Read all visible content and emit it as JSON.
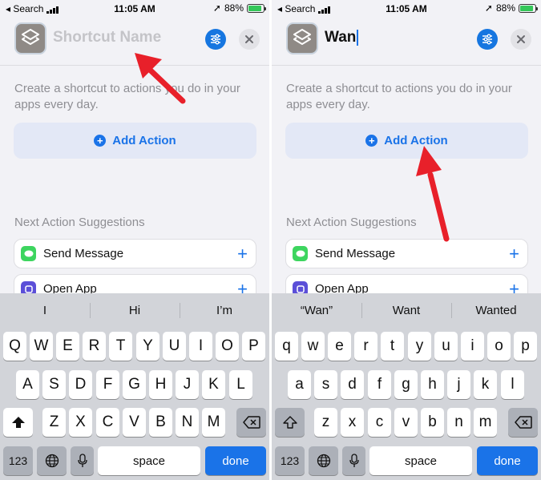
{
  "status_bar": {
    "back_label": "Search",
    "time": "11:05 AM",
    "battery": "88%"
  },
  "left": {
    "name_placeholder": "Shortcut Name",
    "description": "Create a shortcut to actions you do in your apps every day.",
    "add_action_label": "Add Action",
    "suggestions_heading": "Next Action Suggestions",
    "suggestions": [
      {
        "label": "Send Message",
        "icon": "message-icon"
      },
      {
        "label": "Open App",
        "icon": "open-app-icon"
      }
    ],
    "predictions": [
      "I",
      "Hi",
      "I’m"
    ],
    "keyboard": {
      "row1": [
        "Q",
        "W",
        "E",
        "R",
        "T",
        "Y",
        "U",
        "I",
        "O",
        "P"
      ],
      "row2": [
        "A",
        "S",
        "D",
        "F",
        "G",
        "H",
        "J",
        "K",
        "L"
      ],
      "row3": [
        "Z",
        "X",
        "C",
        "V",
        "B",
        "N",
        "M"
      ],
      "numbers_label": "123",
      "space_label": "space",
      "done_label": "done"
    }
  },
  "right": {
    "name_value": "Wan",
    "description": "Create a shortcut to actions you do in your apps every day.",
    "add_action_label": "Add Action",
    "suggestions_heading": "Next Action Suggestions",
    "suggestions": [
      {
        "label": "Send Message",
        "icon": "message-icon"
      },
      {
        "label": "Open App",
        "icon": "open-app-icon"
      }
    ],
    "predictions": [
      "“Wan”",
      "Want",
      "Wanted"
    ],
    "keyboard": {
      "row1": [
        "q",
        "w",
        "e",
        "r",
        "t",
        "y",
        "u",
        "i",
        "o",
        "p"
      ],
      "row2": [
        "a",
        "s",
        "d",
        "f",
        "g",
        "h",
        "j",
        "k",
        "l"
      ],
      "row3": [
        "z",
        "x",
        "c",
        "v",
        "b",
        "n",
        "m"
      ],
      "numbers_label": "123",
      "space_label": "space",
      "done_label": "done"
    }
  },
  "colors": {
    "accent": "#1a73e8",
    "arrow": "#e8202a",
    "battery_fill": "#34c759"
  }
}
